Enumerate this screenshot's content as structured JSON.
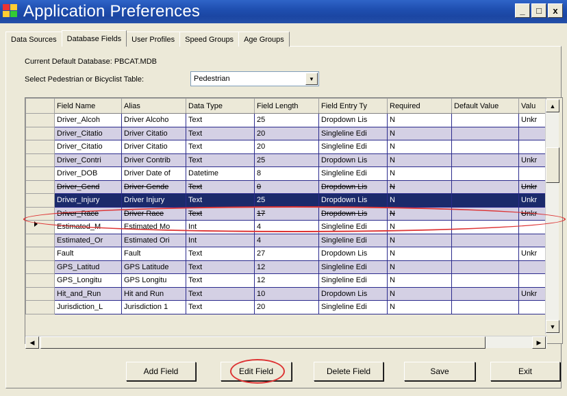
{
  "window": {
    "title": "Application Preferences",
    "minimize": "_",
    "maximize": "□",
    "close": "x"
  },
  "tabs": [
    {
      "label": "Data Sources",
      "active": false
    },
    {
      "label": "Database Fields",
      "active": true
    },
    {
      "label": "User Profiles",
      "active": false
    },
    {
      "label": "Speed Groups",
      "active": false
    },
    {
      "label": "Age Groups",
      "active": false
    }
  ],
  "info": {
    "current_db": "Current Default Database: PBCAT.MDB",
    "select_label": "Select Pedestrian or Bicyclist Table:",
    "select_value": "Pedestrian"
  },
  "grid": {
    "columns": [
      "Field Name",
      "Alias",
      "Data Type",
      "Field Length",
      "Field Entry Ty",
      "Required",
      "Default Value",
      "Valu"
    ],
    "rows": [
      [
        "Driver_Alcoh",
        "Driver Alcoho",
        "Text",
        "25",
        "Dropdown Lis",
        "N",
        "",
        "Unkr"
      ],
      [
        "Driver_Citatio",
        "Driver Citatio",
        "Text",
        "20",
        "Singleline Edi",
        "N",
        "",
        ""
      ],
      [
        "Driver_Citatio",
        "Driver Citatio",
        "Text",
        "20",
        "Singleline Edi",
        "N",
        "",
        ""
      ],
      [
        "Driver_Contri",
        "Driver Contrib",
        "Text",
        "25",
        "Dropdown Lis",
        "N",
        "",
        "Unkr"
      ],
      [
        "Driver_DOB",
        "Driver Date of",
        "Datetime",
        "8",
        "Singleline Edi",
        "N",
        "",
        ""
      ],
      [
        "Driver_Gend",
        "Driver Gende",
        "Text",
        "0",
        "Dropdown Lis",
        "N",
        "",
        "Unkr"
      ],
      [
        "Driver_Injury",
        "Driver Injury",
        "Text",
        "25",
        "Dropdown Lis",
        "N",
        "",
        "Unkr"
      ],
      [
        "Driver_Race",
        "Driver Race",
        "Text",
        "17",
        "Dropdown Lis",
        "N",
        "",
        "Unkr"
      ],
      [
        "Estimated_M",
        "Estimated Mo",
        "Int",
        "4",
        "Singleline Edi",
        "N",
        "",
        ""
      ],
      [
        "Estimated_Or",
        "Estimated Ori",
        "Int",
        "4",
        "Singleline Edi",
        "N",
        "",
        ""
      ],
      [
        "Fault",
        "Fault",
        "Text",
        "27",
        "Dropdown Lis",
        "N",
        "",
        "Unkr"
      ],
      [
        "GPS_Latitud",
        "GPS Latitude",
        "Text",
        "12",
        "Singleline Edi",
        "N",
        "",
        ""
      ],
      [
        "GPS_Longitu",
        "GPS Longitu",
        "Text",
        "12",
        "Singleline Edi",
        "N",
        "",
        ""
      ],
      [
        "Hit_and_Run",
        "Hit and Run",
        "Text",
        "10",
        "Dropdown Lis",
        "N",
        "",
        "Unkr"
      ],
      [
        "Jurisdiction_L",
        "Jurisdiction 1",
        "Text",
        "20",
        "Singleline Edi",
        "N",
        "",
        ""
      ]
    ],
    "selected_row_index": 6,
    "strike_rows": [
      5,
      7
    ]
  },
  "buttons": {
    "add": "Add Field",
    "edit": "Edit Field",
    "delete": "Delete Field",
    "save": "Save",
    "exit": "Exit"
  },
  "colors": {
    "title_bar": "#1f4fb0",
    "selected_row": "#1b2a6b",
    "alt_row": "#d4d0e4",
    "highlight_ellipse": "#d33333"
  }
}
